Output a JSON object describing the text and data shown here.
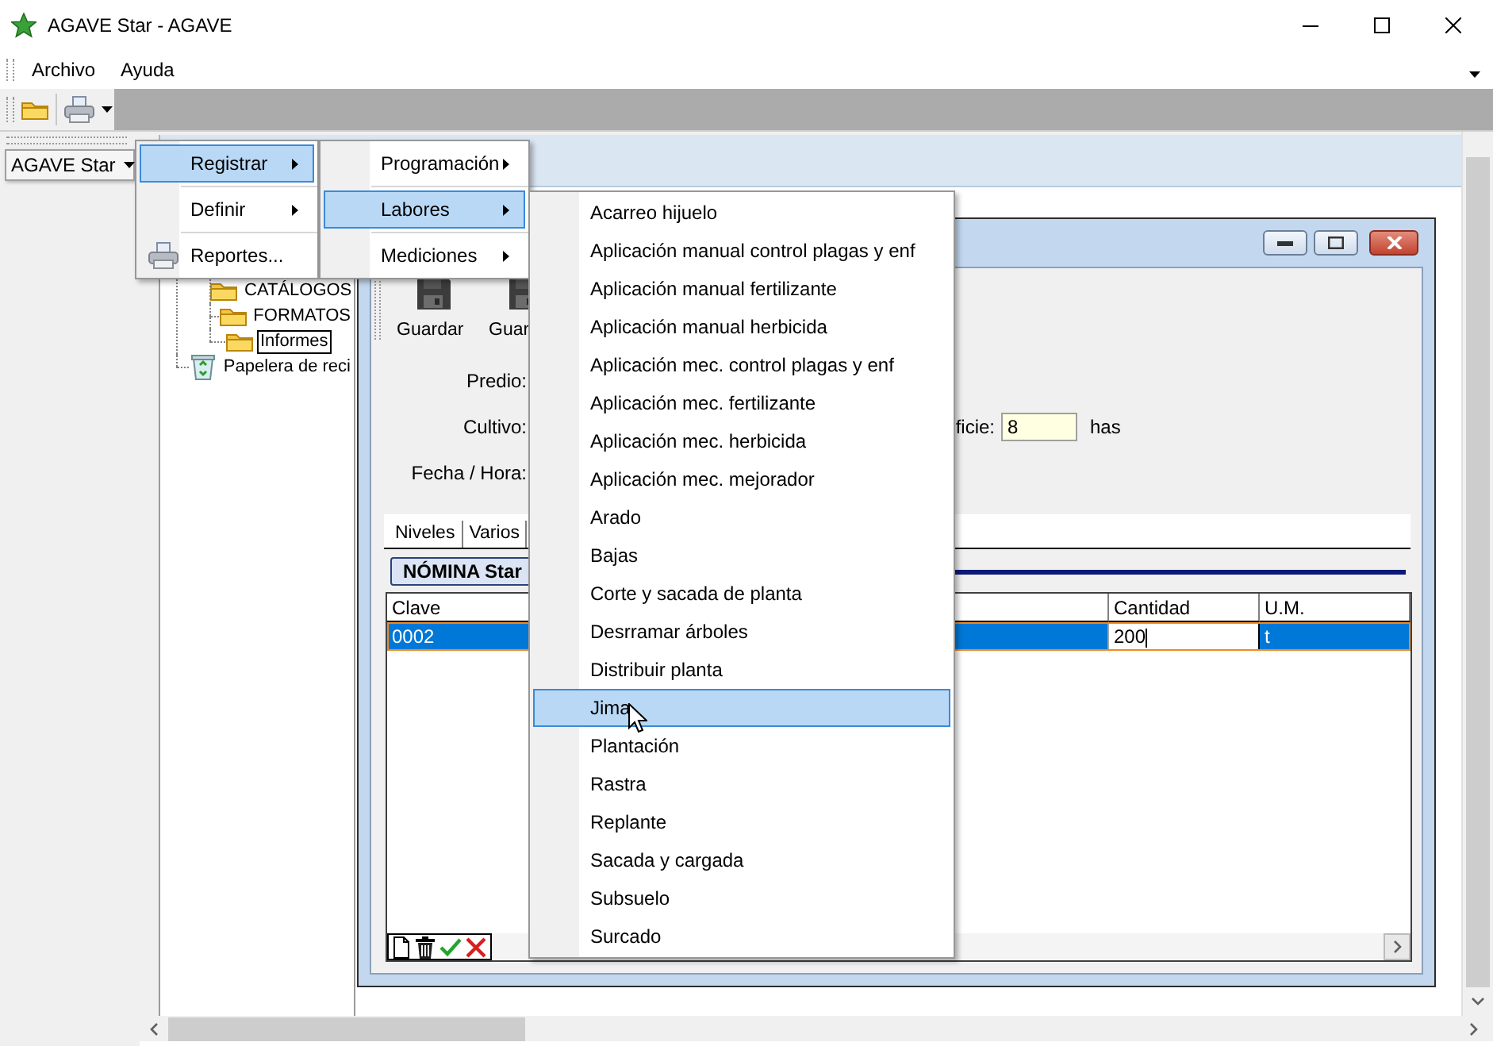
{
  "window": {
    "title": "AGAVE Star - AGAVE"
  },
  "menu_bar": [
    {
      "label": "Archivo"
    },
    {
      "label": "Ayuda"
    }
  ],
  "app_button": {
    "label": "AGAVE Star"
  },
  "tree": [
    {
      "kind": "group",
      "children": [
        {
          "kind": "folder",
          "label": "CATÁLOGOS",
          "selected": false
        },
        {
          "kind": "folder",
          "label": "FORMATOS",
          "selected": false
        },
        {
          "kind": "folder",
          "label": "Informes",
          "selected": true
        }
      ]
    },
    {
      "kind": "recycle",
      "label": "Papelera de reci",
      "selected": false
    }
  ],
  "document": {
    "toolbar": [
      {
        "label": "Guardar"
      },
      {
        "label": "Guar"
      }
    ],
    "fields": [
      {
        "label": "Predio:"
      },
      {
        "label": "Cultivo:"
      },
      {
        "label": "Fecha / Hora:"
      }
    ],
    "area": {
      "label": "ficie:",
      "value": "8",
      "unit": "has"
    },
    "tabs": [
      {
        "label": "Niveles",
        "selected": false
      },
      {
        "label": "Varios",
        "selected": false
      }
    ],
    "section": "NÓMINA Star",
    "grid": {
      "columns": [
        "Clave",
        "Cantidad",
        "U.M."
      ],
      "rows": [
        {
          "selected": true,
          "cells": [
            {
              "text": "0002",
              "editing": false
            },
            {
              "text": "200",
              "editing": true
            },
            {
              "text": "t",
              "editing": false
            }
          ]
        }
      ]
    }
  },
  "menus": [
    {
      "items": [
        {
          "label": "Registrar",
          "submenu": true,
          "selected": true,
          "icon": false
        },
        {
          "label": "Definir",
          "submenu": true,
          "selected": false,
          "icon": false
        },
        {
          "label": "Reportes...",
          "submenu": false,
          "selected": false,
          "icon": true
        }
      ]
    },
    {
      "items": [
        {
          "label": "Programación",
          "submenu": true,
          "selected": false
        },
        {
          "label": "Labores",
          "submenu": true,
          "selected": true
        },
        {
          "label": "Mediciones",
          "submenu": true,
          "selected": false
        }
      ]
    },
    {
      "items": [
        {
          "label": "Acarreo hijuelo",
          "submenu": false,
          "selected": false
        },
        {
          "label": "Aplicación manual control plagas y enf",
          "submenu": false,
          "selected": false
        },
        {
          "label": "Aplicación manual fertilizante",
          "submenu": false,
          "selected": false
        },
        {
          "label": "Aplicación manual herbicida",
          "submenu": false,
          "selected": false
        },
        {
          "label": "Aplicación mec. control plagas y enf",
          "submenu": false,
          "selected": false
        },
        {
          "label": "Aplicación mec. fertilizante",
          "submenu": false,
          "selected": false
        },
        {
          "label": "Aplicación mec. herbicida",
          "submenu": false,
          "selected": false
        },
        {
          "label": "Aplicación mec. mejorador",
          "submenu": false,
          "selected": false
        },
        {
          "label": "Arado",
          "submenu": false,
          "selected": false
        },
        {
          "label": "Bajas",
          "submenu": false,
          "selected": false
        },
        {
          "label": "Corte y sacada de planta",
          "submenu": false,
          "selected": false
        },
        {
          "label": "Desrramar árboles",
          "submenu": false,
          "selected": false
        },
        {
          "label": "Distribuir planta",
          "submenu": false,
          "selected": false
        },
        {
          "label": "Jima",
          "submenu": false,
          "selected": true
        },
        {
          "label": "Plantación",
          "submenu": false,
          "selected": false
        },
        {
          "label": "Rastra",
          "submenu": false,
          "selected": false
        },
        {
          "label": "Replante",
          "submenu": false,
          "selected": false
        },
        {
          "label": "Sacada y cargada",
          "submenu": false,
          "selected": false
        },
        {
          "label": "Subsuelo",
          "submenu": false,
          "selected": false
        },
        {
          "label": "Surcado",
          "submenu": false,
          "selected": false
        }
      ]
    }
  ]
}
